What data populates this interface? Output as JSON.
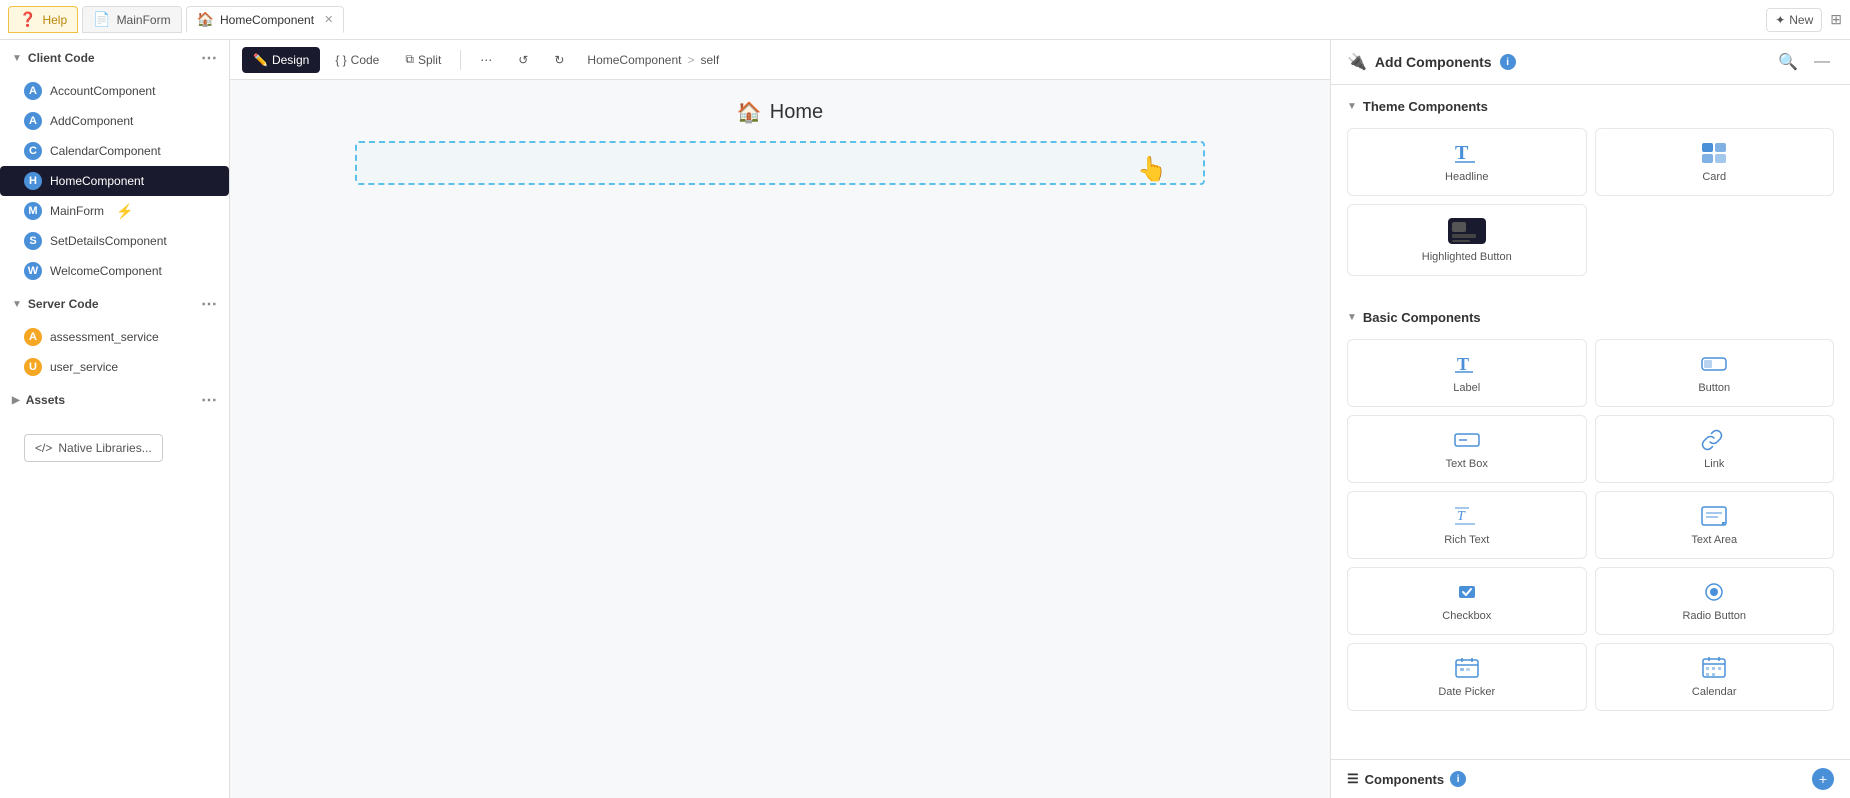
{
  "tabs": [
    {
      "id": "help",
      "label": "Help",
      "icon": "❓",
      "type": "help"
    },
    {
      "id": "mainform",
      "label": "MainForm",
      "icon": "📄",
      "type": "mainform"
    },
    {
      "id": "homecomp",
      "label": "HomeComponent",
      "icon": "🏠",
      "type": "homecomp",
      "active": true,
      "closable": true
    }
  ],
  "toolbar": {
    "design_label": "Design",
    "code_label": "Code",
    "split_label": "Split",
    "breadcrumb_component": "HomeComponent",
    "breadcrumb_sep": ">",
    "breadcrumb_self": "self"
  },
  "new_button_label": "New",
  "sidebar": {
    "client_code_section": "Client Code",
    "items": [
      {
        "id": "AccountComponent",
        "label": "AccountComponent",
        "icon_type": "blue"
      },
      {
        "id": "AddComponent",
        "label": "AddComponent",
        "icon_type": "blue"
      },
      {
        "id": "CalendarComponent",
        "label": "CalendarComponent",
        "icon_type": "blue"
      },
      {
        "id": "HomeComponent",
        "label": "HomeComponent",
        "icon_type": "blue",
        "active": true
      },
      {
        "id": "MainForm",
        "label": "MainForm",
        "icon_type": "blue",
        "has_bolt": true
      },
      {
        "id": "SetDetailsComponent",
        "label": "SetDetailsComponent",
        "icon_type": "blue"
      },
      {
        "id": "WelcomeComponent",
        "label": "WelcomeComponent",
        "icon_type": "blue"
      }
    ],
    "server_code_section": "Server Code",
    "server_items": [
      {
        "id": "assessment_service",
        "label": "assessment_service",
        "icon_type": "orange"
      },
      {
        "id": "user_service",
        "label": "user_service",
        "icon_type": "orange"
      }
    ],
    "assets_section": "Assets",
    "native_lib_label": "Native Libraries..."
  },
  "canvas": {
    "title": "Home",
    "title_icon": "🏠"
  },
  "right_panel": {
    "title": "Add Components",
    "info": "i",
    "theme_components_label": "Theme Components",
    "components": [
      {
        "id": "headline",
        "label": "Headline",
        "icon": "T"
      },
      {
        "id": "card",
        "label": "Card",
        "icon": "card"
      }
    ],
    "highlighted_button": {
      "label": "Highlighted Button",
      "icon": "highlight"
    },
    "basic_components_label": "Basic Components",
    "basic_components": [
      {
        "id": "label",
        "label": "Label",
        "icon": "T"
      },
      {
        "id": "button",
        "label": "Button",
        "icon": "btn"
      },
      {
        "id": "textbox",
        "label": "Text Box",
        "icon": "textbox"
      },
      {
        "id": "link",
        "label": "Link",
        "icon": "link"
      },
      {
        "id": "richtext",
        "label": "Rich Text",
        "icon": "richtext"
      },
      {
        "id": "textarea",
        "label": "Text Area",
        "icon": "textarea"
      },
      {
        "id": "checkbox",
        "label": "Checkbox",
        "icon": "checkbox"
      },
      {
        "id": "radiobutton",
        "label": "Radio Button",
        "icon": "radio"
      },
      {
        "id": "datepicker",
        "label": "Date Picker",
        "icon": "date"
      },
      {
        "id": "calendar",
        "label": "Calendar",
        "icon": "calendar"
      }
    ]
  },
  "bottom_bar": {
    "label": "Components",
    "info": "i"
  }
}
